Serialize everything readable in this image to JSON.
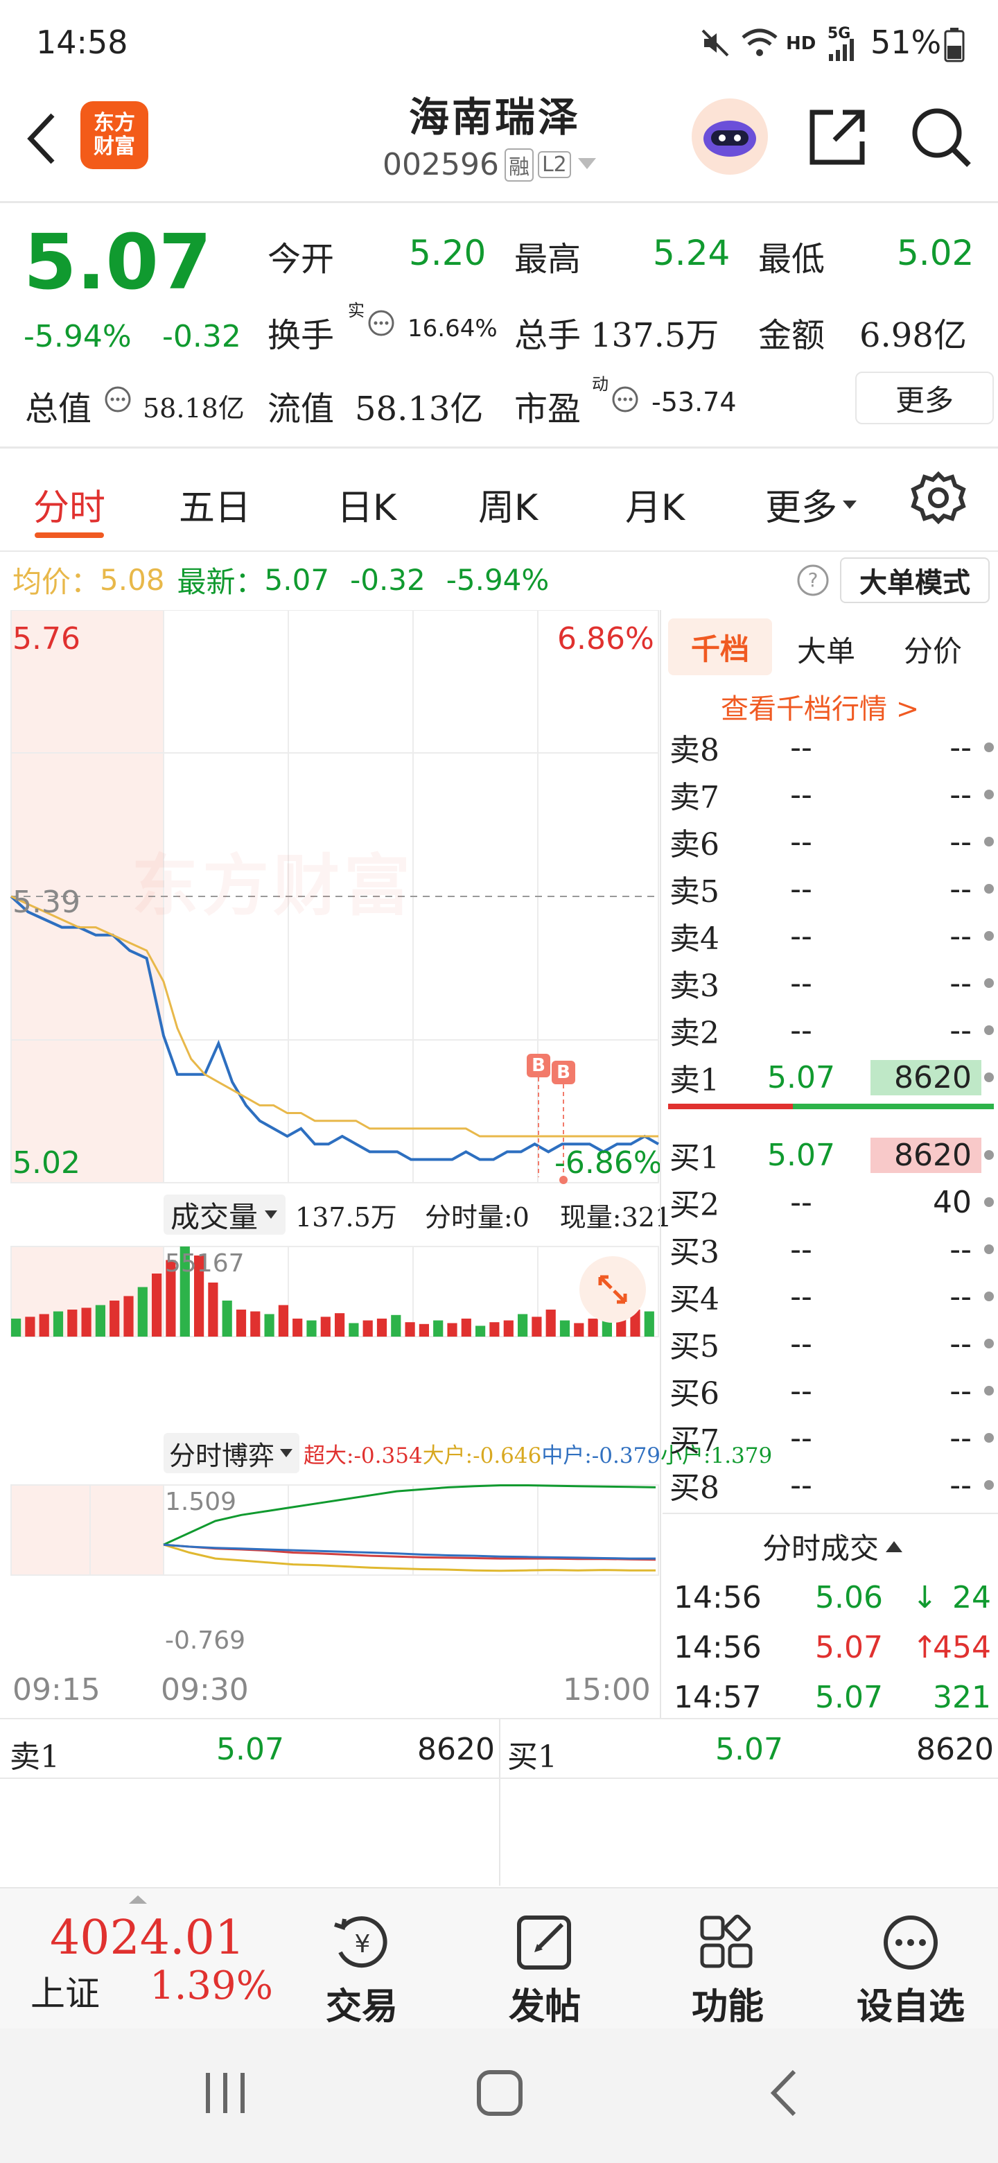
{
  "status": {
    "time": "14:58",
    "hd": "HD",
    "net": "5G",
    "battery": "51%"
  },
  "header": {
    "name": "海南瑞泽",
    "code": "002596",
    "badge_rong": "融",
    "badge_l2": "L2",
    "logo": "东方\n财富"
  },
  "quote": {
    "price": "5.07",
    "change_pct": "-5.94%",
    "change": "-0.32",
    "open_label": "今开",
    "open": "5.20",
    "high_label": "最高",
    "high": "5.24",
    "low_label": "最低",
    "low": "5.02",
    "turnover_label": "换手",
    "turnover_sup": "实",
    "turnover": "16.64%",
    "volume_label": "总手",
    "volume": "137.5万",
    "amount_label": "金额",
    "amount": "6.98亿",
    "mcap_label": "总值",
    "mcap": "58.18亿",
    "float_label": "流值",
    "float": "58.13亿",
    "pe_label": "市盈",
    "pe_sup": "动",
    "pe": "-53.74",
    "more": "更多"
  },
  "tabs": [
    "分时",
    "五日",
    "日K",
    "周K",
    "月K",
    "更多"
  ],
  "infobar": {
    "avg_label": "均价：",
    "avg": "5.08",
    "last_label": "最新：",
    "last": "5.07",
    "chg": "-0.32",
    "pct": "-5.94%",
    "mode_btn": "大单模式"
  },
  "chart_data": [
    {
      "type": "line",
      "name": "intraday-price",
      "y_top_label": "5.76",
      "y_top_pct": "6.86%",
      "y_mid_label": "5.39",
      "y_bottom_label": "5.02",
      "y_bottom_pct": "-6.86%",
      "ylim": [
        5.02,
        5.76
      ],
      "watermark": "东方财富",
      "series": [
        {
          "name": "price",
          "color": "#2d6fc0",
          "values": [
            5.39,
            5.37,
            5.36,
            5.35,
            5.35,
            5.34,
            5.34,
            5.32,
            5.31,
            5.21,
            5.16,
            5.16,
            5.16,
            5.2,
            5.15,
            5.12,
            5.1,
            5.09,
            5.08,
            5.09,
            5.07,
            5.07,
            5.08,
            5.07,
            5.06,
            5.06,
            5.06,
            5.05,
            5.05,
            5.05,
            5.05,
            5.06,
            5.05,
            5.05,
            5.06,
            5.06,
            5.07,
            5.06,
            5.07,
            5.07,
            5.07,
            5.06,
            5.07,
            5.07,
            5.08,
            5.07
          ]
        },
        {
          "name": "avg",
          "color": "#e8b84a",
          "values": [
            5.39,
            5.38,
            5.37,
            5.36,
            5.35,
            5.35,
            5.34,
            5.33,
            5.32,
            5.28,
            5.22,
            5.18,
            5.16,
            5.15,
            5.14,
            5.13,
            5.12,
            5.12,
            5.11,
            5.11,
            5.1,
            5.1,
            5.1,
            5.1,
            5.09,
            5.09,
            5.09,
            5.09,
            5.09,
            5.09,
            5.09,
            5.09,
            5.08,
            5.08,
            5.08,
            5.08,
            5.08,
            5.08,
            5.08,
            5.08,
            5.08,
            5.08,
            5.08,
            5.08,
            5.08,
            5.08
          ]
        }
      ]
    },
    {
      "type": "bar",
      "name": "volume",
      "max_label": "55167",
      "values": [
        20,
        22,
        25,
        28,
        30,
        32,
        35,
        40,
        45,
        55,
        70,
        85,
        100,
        90,
        60,
        40,
        30,
        28,
        25,
        35,
        20,
        18,
        22,
        26,
        15,
        18,
        20,
        24,
        16,
        14,
        18,
        15,
        20,
        12,
        16,
        18,
        25,
        22,
        30,
        18,
        15,
        20,
        26,
        22,
        30,
        28
      ]
    },
    {
      "type": "line",
      "name": "capital-flow",
      "top_label": "1.509",
      "bottom_label": "-0.769",
      "ylim": [
        -0.769,
        1.509
      ],
      "series": [
        {
          "name": "超大",
          "color": "#109a2f",
          "values": [
            0,
            0.3,
            0.6,
            0.75,
            0.85,
            0.95,
            1.05,
            1.15,
            1.25,
            1.35,
            1.4,
            1.45,
            1.48,
            1.5,
            1.5,
            1.49,
            1.48,
            1.47,
            1.46,
            1.45
          ]
        },
        {
          "name": "大户",
          "color": "#e0b830",
          "values": [
            0,
            -0.2,
            -0.35,
            -0.4,
            -0.45,
            -0.5,
            -0.52,
            -0.55,
            -0.58,
            -0.6,
            -0.62,
            -0.63,
            -0.65,
            -0.66,
            -0.65,
            -0.64,
            -0.65,
            -0.64,
            -0.65,
            -0.65
          ]
        },
        {
          "name": "中户",
          "color": "#d04040",
          "values": [
            0,
            -0.05,
            -0.1,
            -0.12,
            -0.15,
            -0.2,
            -0.22,
            -0.25,
            -0.28,
            -0.3,
            -0.32,
            -0.33,
            -0.34,
            -0.35,
            -0.35,
            -0.35,
            -0.36,
            -0.36,
            -0.37,
            -0.38
          ]
        },
        {
          "name": "小户",
          "color": "#3070c0",
          "values": [
            0,
            -0.05,
            -0.08,
            -0.1,
            -0.12,
            -0.14,
            -0.16,
            -0.18,
            -0.2,
            -0.22,
            -0.25,
            -0.27,
            -0.28,
            -0.3,
            -0.31,
            -0.32,
            -0.33,
            -0.34,
            -0.35,
            -0.35
          ]
        }
      ]
    }
  ],
  "volume_bar": {
    "label": "成交量",
    "total": "137.5万",
    "tick_label": "分时量:0",
    "now_label": "现量:321"
  },
  "flow_bar": {
    "label": "分时博弈",
    "s1": "超大:-0.354",
    "s2": "大户:-0.646",
    "s3": "中户:-0.379",
    "s4": "小户:1.379"
  },
  "time_axis": {
    "t1": "09:15",
    "t2": "09:30",
    "t3": "15:00"
  },
  "orderbook": {
    "tabs": [
      "千档",
      "大单",
      "分价"
    ],
    "link": "查看千档行情 >",
    "asks": [
      {
        "label": "卖8",
        "price": "--",
        "vol": "--"
      },
      {
        "label": "卖7",
        "price": "--",
        "vol": "--"
      },
      {
        "label": "卖6",
        "price": "--",
        "vol": "--"
      },
      {
        "label": "卖5",
        "price": "--",
        "vol": "--"
      },
      {
        "label": "卖4",
        "price": "--",
        "vol": "--"
      },
      {
        "label": "卖3",
        "price": "--",
        "vol": "--"
      },
      {
        "label": "卖2",
        "price": "--",
        "vol": "--"
      },
      {
        "label": "卖1",
        "price": "5.07",
        "vol": "8620"
      }
    ],
    "bids": [
      {
        "label": "买1",
        "price": "5.07",
        "vol": "8620"
      },
      {
        "label": "买2",
        "price": "--",
        "vol": "40"
      },
      {
        "label": "买3",
        "price": "--",
        "vol": "--"
      },
      {
        "label": "买4",
        "price": "--",
        "vol": "--"
      },
      {
        "label": "买5",
        "price": "--",
        "vol": "--"
      },
      {
        "label": "买6",
        "price": "--",
        "vol": "--"
      },
      {
        "label": "买7",
        "price": "--",
        "vol": "--"
      },
      {
        "label": "买8",
        "price": "--",
        "vol": "--"
      }
    ],
    "ticks_title": "分时成交",
    "ticks": [
      {
        "time": "14:56",
        "price": "5.06",
        "arrow": "↓",
        "vol": "24"
      },
      {
        "time": "14:56",
        "price": "5.07",
        "arrow": "↑",
        "vol": "454"
      },
      {
        "time": "14:57",
        "price": "5.07",
        "arrow": "",
        "vol": "321"
      }
    ]
  },
  "level1": {
    "sell_label": "卖1",
    "sell_price": "5.07",
    "sell_vol": "8620",
    "buy_label": "买1",
    "buy_price": "5.07",
    "buy_vol": "8620"
  },
  "index": {
    "value": "4024.01",
    "name": "上证",
    "pct": "1.39%"
  },
  "bottom_nav": {
    "trade": "交易",
    "post": "发帖",
    "func": "功能",
    "watch": "设自选"
  }
}
